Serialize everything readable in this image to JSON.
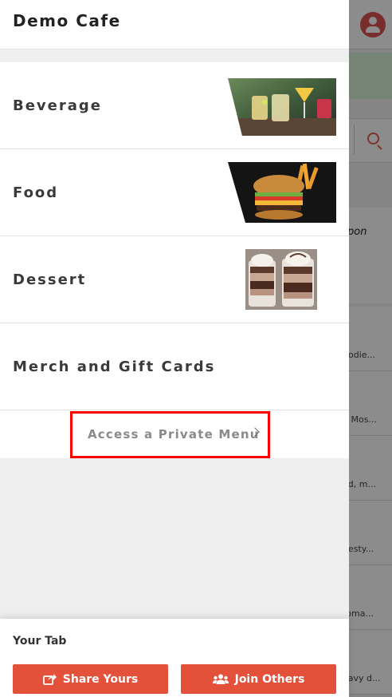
{
  "drawer": {
    "title": "Demo Cafe",
    "categories": [
      {
        "label": "Beverage",
        "image": "beverage-image"
      },
      {
        "label": "Food",
        "image": "food-image"
      },
      {
        "label": "Dessert",
        "image": "dessert-image"
      },
      {
        "label": "Merch and Gift Cards",
        "image": ""
      }
    ],
    "access_private_menu": "Access a Private Menu"
  },
  "tab": {
    "title": "Your Tab",
    "share_label": "Share Yours",
    "join_label": "Join Others"
  },
  "background": {
    "coupon_text": "pon",
    "list_snippets": [
      "bodie...",
      "h Mos...",
      "ed, m...",
      "ifesty...",
      "roma...",
      "eavy d..."
    ]
  },
  "colors": {
    "accent": "#e4513b",
    "highlight_box": "#ff0000"
  },
  "icons": [
    "user-avatar-icon",
    "search-icon",
    "chevron-right-icon",
    "share-icon",
    "users-icon"
  ]
}
